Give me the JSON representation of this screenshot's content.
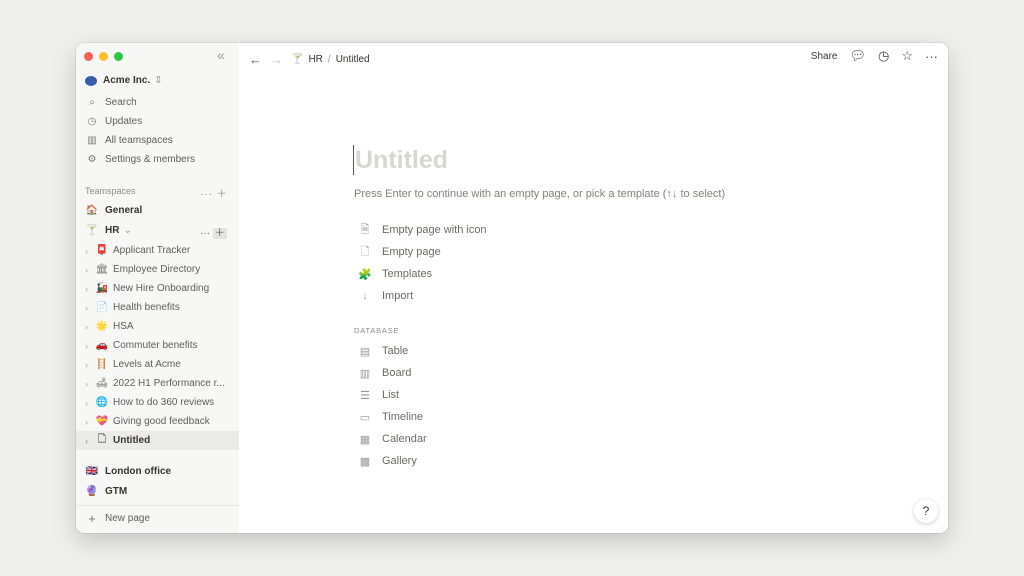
{
  "workspace": {
    "name": "Acme Inc."
  },
  "sidebar": {
    "nav": [
      {
        "label": "Search",
        "icon": "search-icon"
      },
      {
        "label": "Updates",
        "icon": "clock-icon"
      },
      {
        "label": "All teamspaces",
        "icon": "building-icon"
      },
      {
        "label": "Settings & members",
        "icon": "gear-icon"
      }
    ],
    "teamspaces_header": "Teamspaces",
    "general": "General",
    "hr": "HR",
    "pages": [
      {
        "label": "Applicant Tracker",
        "icon": "📮"
      },
      {
        "label": "Employee Directory",
        "icon": "🏛"
      },
      {
        "label": "New Hire Onboarding",
        "icon": "🚂"
      },
      {
        "label": "Health benefits",
        "icon": "📄"
      },
      {
        "label": "HSA",
        "icon": "🌟"
      },
      {
        "label": "Commuter benefits",
        "icon": "🚗"
      },
      {
        "label": "Levels at Acme",
        "icon": "🪜"
      },
      {
        "label": "2022 H1 Performance r...",
        "icon": "🛋"
      },
      {
        "label": "How to do 360 reviews",
        "icon": "🌐"
      },
      {
        "label": "Giving good feedback",
        "icon": "💝"
      },
      {
        "label": "Untitled",
        "icon": "🗋"
      }
    ],
    "other_teamspaces": [
      {
        "label": "London office",
        "icon": "🇬🇧"
      },
      {
        "label": "GTM",
        "icon": "🔮"
      }
    ],
    "new_page": "New page"
  },
  "topbar": {
    "breadcrumb": [
      "HR",
      "Untitled"
    ],
    "separator": "/",
    "share": "Share"
  },
  "page": {
    "title_placeholder": "Untitled",
    "hint": "Press Enter to continue with an empty page, or pick a template (↑↓ to select)",
    "options": [
      {
        "label": "Empty page with icon",
        "icon": "🗎"
      },
      {
        "label": "Empty page",
        "icon": "🗋"
      },
      {
        "label": "Templates",
        "icon": "🧩"
      },
      {
        "label": "Import",
        "icon": "↓"
      }
    ],
    "database_header": "DATABASE",
    "database": [
      {
        "label": "Table",
        "icon": "▤"
      },
      {
        "label": "Board",
        "icon": "▥"
      },
      {
        "label": "List",
        "icon": "☰"
      },
      {
        "label": "Timeline",
        "icon": "▭"
      },
      {
        "label": "Calendar",
        "icon": "▦"
      },
      {
        "label": "Gallery",
        "icon": "▩"
      }
    ]
  },
  "help": "?"
}
